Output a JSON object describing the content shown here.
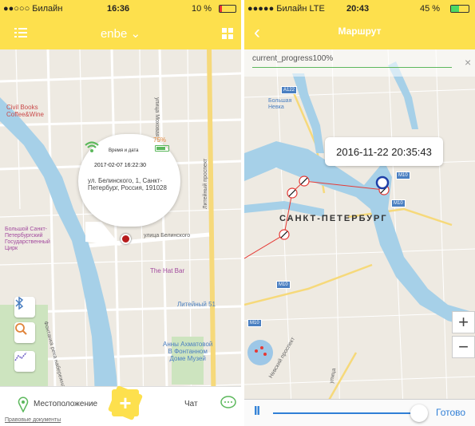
{
  "left": {
    "status": {
      "carrier": "●●○○○ Билайн",
      "time": "16:36",
      "battery": "10 %"
    },
    "nav": {
      "title": "enbe ⌄"
    },
    "map_labels": {
      "books": "Civil Books\nCoffee&Wine",
      "theater": "Большой Санкт-\nПетербургский\nГосударственный\nЦирк",
      "belinsky": "улица Белинского",
      "hatbar": "The Hat Bar",
      "liteyny51": "Литейный 51",
      "akhmatova": "Анны Ахматовой\nВ Фонтанном\nДоме Музей",
      "fontanka": "Фонтанка река набережная",
      "liteyny": "Литейный проспект",
      "mokhovaya": "улица Моховая",
      "legal": "Правовые документы"
    },
    "popup": {
      "battery_pct": "75%",
      "time_label": "Время и дата",
      "datetime": "2017-02-07 16:22:30",
      "address": "ул. Белинского, 1, Санкт-Петербург, Россия, 191028"
    },
    "bottom": {
      "location": "Местоположение",
      "chat": "Чат"
    }
  },
  "right": {
    "status": {
      "carrier": "●●●●● Билайн  LTE",
      "time": "20:43",
      "battery": "45 %"
    },
    "nav": {
      "back": "‹",
      "title": "Маршрут"
    },
    "progress": {
      "label": "current_progress100%",
      "value": 1.0
    },
    "popup_datetime": "2016-11-22 20:35:43",
    "city": "Санкт-Петербург",
    "roads": {
      "a122": "A122",
      "m10a": "M10",
      "m10b": "M10",
      "m10c": "M10",
      "m10d": "M10"
    },
    "map_labels": {
      "nevka": "Большая\nНевка",
      "nevsky": "Невский проспект",
      "ulica": "улица"
    },
    "zoom_in": "+",
    "zoom_out": "−",
    "pause": "II",
    "done": "Готово"
  }
}
